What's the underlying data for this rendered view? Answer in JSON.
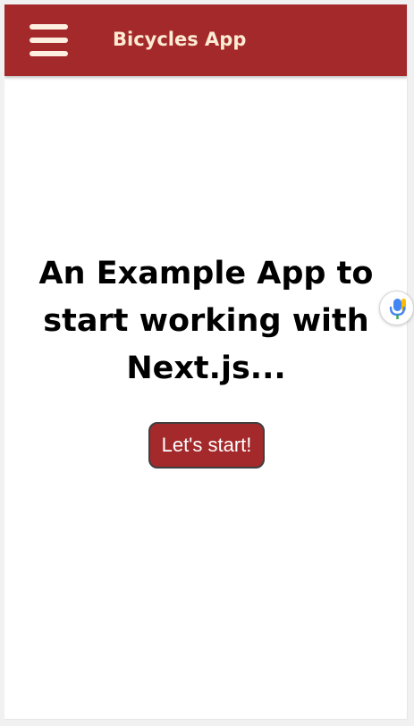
{
  "header": {
    "title": "Bicycles App",
    "menu_icon": "hamburger-menu-icon"
  },
  "hero": {
    "heading_line1": "An Example App to",
    "heading_line2": "start working with",
    "heading_line3": "Next.js...",
    "cta_label": "Let's start!"
  },
  "widget": {
    "icon": "microphone-icon"
  },
  "colors": {
    "brand": "#a4292b",
    "header_text": "#fdebd4",
    "background": "#ffffff",
    "heading_text": "#000000",
    "button_text": "#ffffff"
  }
}
